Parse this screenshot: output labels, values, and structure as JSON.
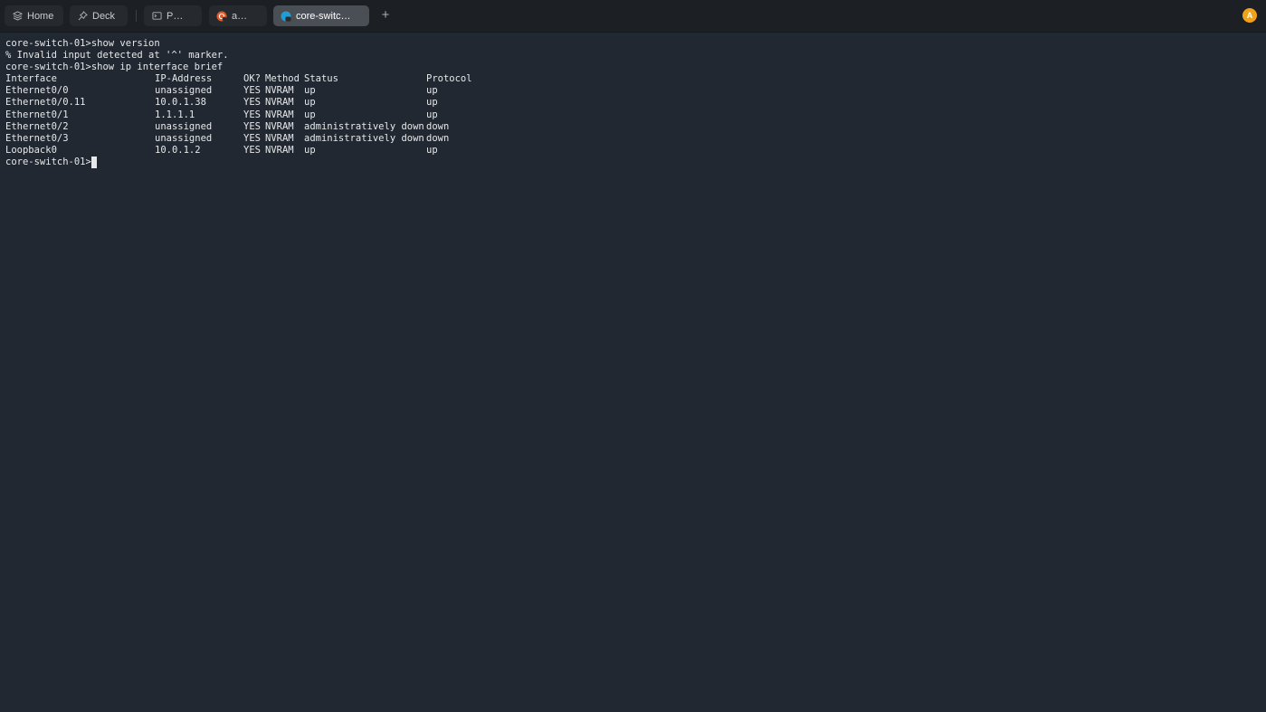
{
  "tabs": [
    {
      "label": "Home",
      "icon": "layers-icon"
    },
    {
      "label": "Deck",
      "icon": "pin-icon"
    },
    {
      "label": "P…",
      "icon": "terminal-prompt-icon"
    },
    {
      "label": "a…",
      "icon": "ubuntu-icon"
    },
    {
      "label": "core-switc…",
      "icon": "network-device-icon",
      "active": true
    }
  ],
  "new_tab_label": "+",
  "avatar_letter": "A",
  "terminal": {
    "lines": [
      "core-switch-01>show version",
      "% Invalid input detected at '^' marker.",
      "core-switch-01>show ip interface brief"
    ],
    "header": {
      "interface": "Interface",
      "ip": "IP-Address",
      "ok": "OK?",
      "method": "Method",
      "status": "Status",
      "protocol": "Protocol"
    },
    "rows": [
      {
        "interface": "Ethernet0/0",
        "ip": "unassigned",
        "ok": "YES",
        "method": "NVRAM",
        "status": "up",
        "protocol": "up"
      },
      {
        "interface": "Ethernet0/0.11",
        "ip": "10.0.1.38",
        "ok": "YES",
        "method": "NVRAM",
        "status": "up",
        "protocol": "up"
      },
      {
        "interface": "Ethernet0/1",
        "ip": "1.1.1.1",
        "ok": "YES",
        "method": "NVRAM",
        "status": "up",
        "protocol": "up"
      },
      {
        "interface": "Ethernet0/2",
        "ip": "unassigned",
        "ok": "YES",
        "method": "NVRAM",
        "status": "administratively down",
        "protocol": "down"
      },
      {
        "interface": "Ethernet0/3",
        "ip": "unassigned",
        "ok": "YES",
        "method": "NVRAM",
        "status": "administratively down",
        "protocol": "down"
      },
      {
        "interface": "Loopback0",
        "ip": "10.0.1.2",
        "ok": "YES",
        "method": "NVRAM",
        "status": "up",
        "protocol": "up"
      }
    ],
    "prompt": "core-switch-01>"
  },
  "colors": {
    "background": "#222831",
    "tabbar": "#1c1f23",
    "active_tab": "#4a4f56",
    "avatar": "#f0a21a",
    "text": "#e6e8ea"
  }
}
